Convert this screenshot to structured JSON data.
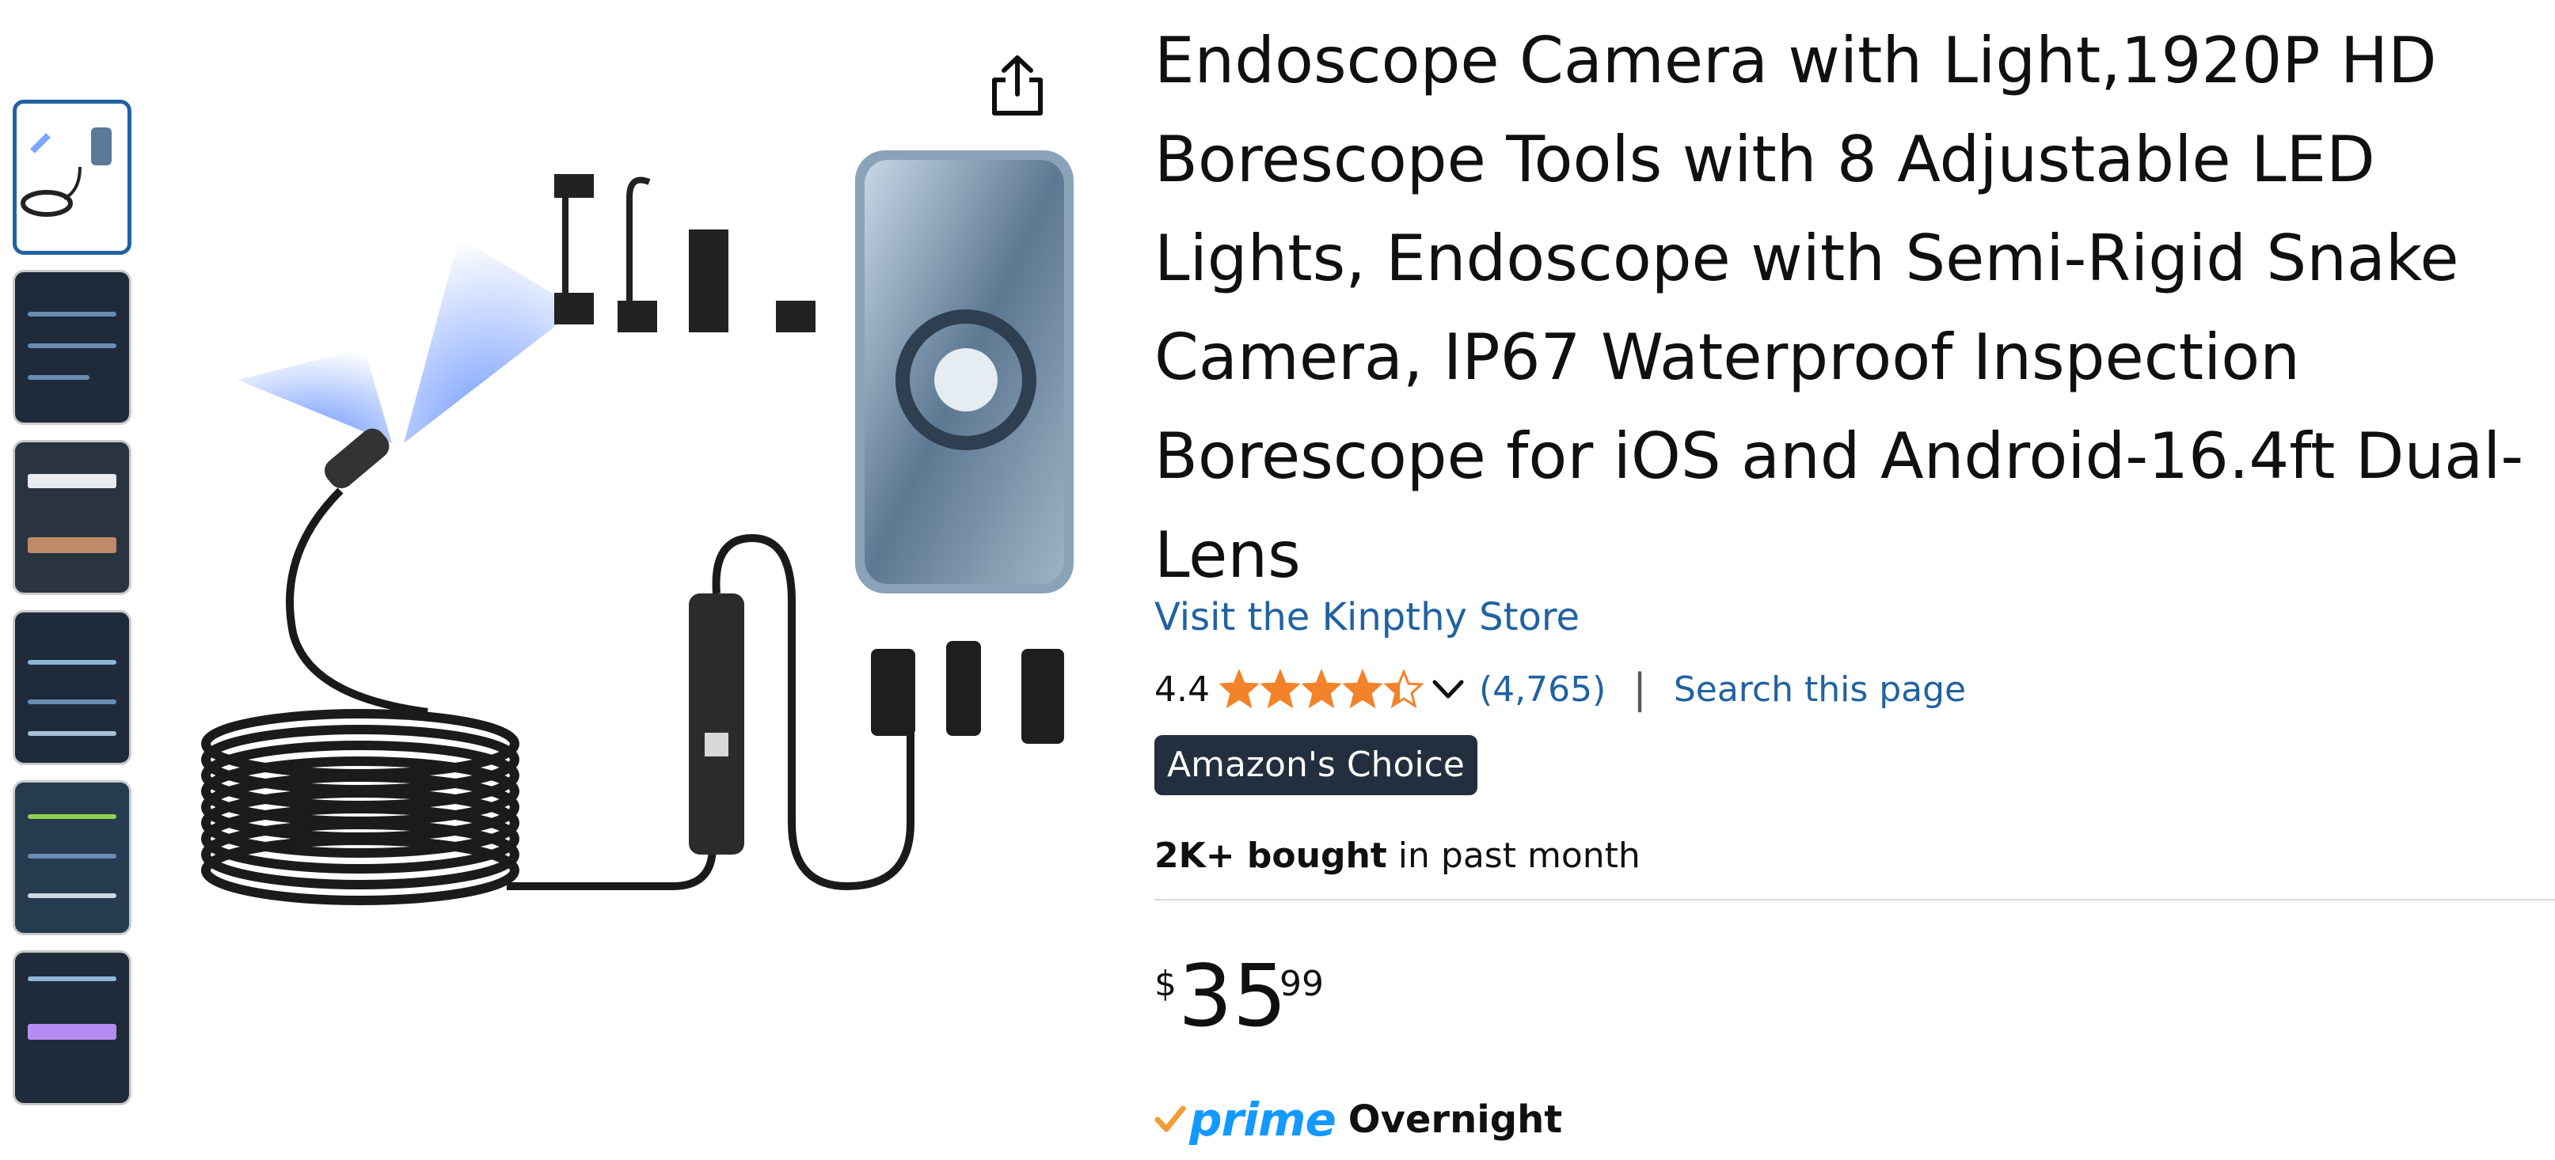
{
  "product": {
    "title": "Endoscope Camera with Light,1920P HD Borescope Tools with 8 Adjustable LED Lights, Endoscope with Semi-Rigid Snake Camera, IP67 Waterproof Inspection Borescope for iOS and Android-16.4ft Dual-Lens",
    "store_link": "Visit the Kinpthy Store",
    "rating": "4.4",
    "rating_stars": 4.4,
    "rating_count": "(4,765)",
    "separator": "|",
    "search_link": "Search this page",
    "badge": "Amazon's Choice",
    "bought_bold": "2K+ bought",
    "bought_rest": " in past month",
    "price": {
      "symbol": "$",
      "whole": "35",
      "fraction": "99"
    },
    "prime": {
      "label": "prime",
      "speed": "Overnight"
    }
  },
  "gallery": {
    "thumbnail_count": 6,
    "selected_index": 0
  },
  "colors": {
    "link": "#2162a1",
    "star": "#f3832a",
    "badge_bg": "#232f3e",
    "prime_blue": "#1399ff",
    "prime_check": "#f29d38",
    "selected_thumb_border": "#2162a1"
  },
  "icons": {
    "share": "share-icon",
    "chevron": "chevron-down-icon",
    "star": "star-icon",
    "prime_check": "prime-check-icon"
  }
}
